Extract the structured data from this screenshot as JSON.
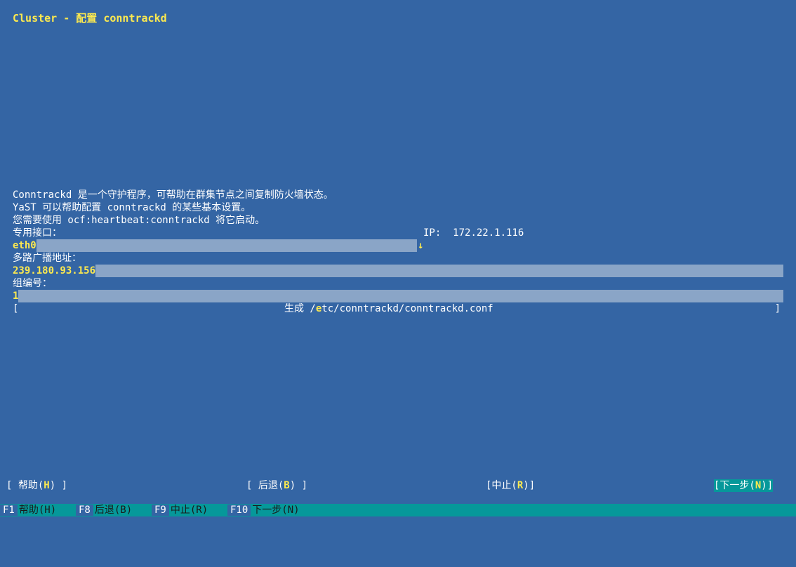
{
  "window": {
    "title": "Cluster - 配置 conntrackd"
  },
  "description": {
    "line1": "Conntrackd 是一个守护程序，可帮助在群集节点之间复制防火墙状态。",
    "line2": "YaST 可以帮助配置 conntrackd 的某些基本设置。",
    "line3": "您需要使用 ocf:heartbeat:conntrackd 将它启动。"
  },
  "form": {
    "interface_label": "专用接口：",
    "interface_value": "eth0",
    "interface_arrow": "↓",
    "ip_label": "IP:",
    "ip_value": "172.22.1.116",
    "multicast_label": "多路广播地址：",
    "multicast_value": "239.180.93.156",
    "group_label": "组编号：",
    "group_value": "1",
    "generate_prefix": "生成 /",
    "generate_hotkey": "e",
    "generate_suffix": "tc/conntrackd/conntrackd.conf"
  },
  "buttons": {
    "help": {
      "pre": "[ 帮助(",
      "key": "H",
      "post": ") ]"
    },
    "back": {
      "pre": "[ 后退(",
      "key": "B",
      "post": ") ]"
    },
    "abort": {
      "pre": "[中止(",
      "key": "R",
      "post": ")]"
    },
    "next": {
      "pre": "[下一步(",
      "key": "N",
      "post": ")]"
    }
  },
  "fkeys": [
    {
      "key": "F1",
      "label": "帮助(H)"
    },
    {
      "key": "F8",
      "label": "后退(B)"
    },
    {
      "key": "F9",
      "label": "中止(R)"
    },
    {
      "key": "F10",
      "label": "下一步(N)"
    }
  ]
}
